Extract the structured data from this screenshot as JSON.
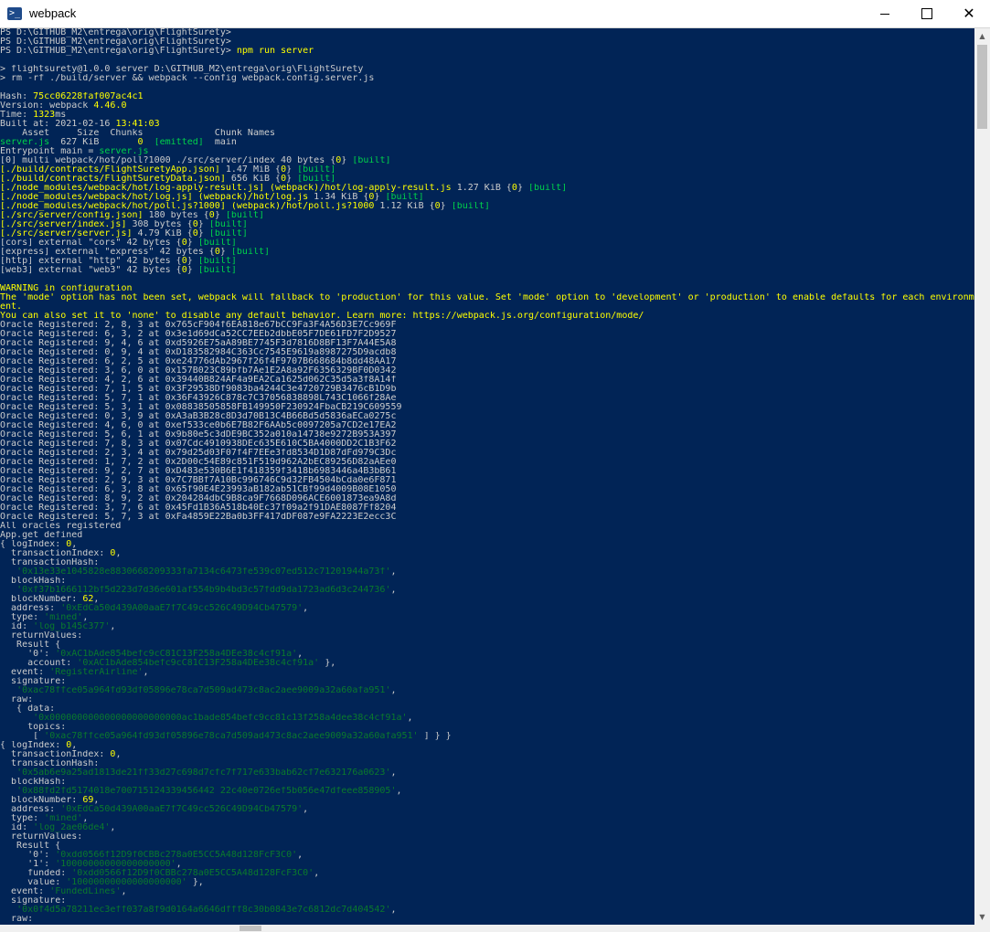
{
  "window": {
    "title": "webpack",
    "icon": "powershell-icon",
    "minimize_icon": "minimize-icon",
    "maximize_icon": "maximize-icon",
    "close_icon": "close-icon"
  },
  "colors": {
    "background": "#012456",
    "text": "#cccccc",
    "yellow": "#ffff00",
    "green": "#00d24a",
    "dark_green": "#0a7a2c",
    "gray": "#9a9a9a"
  },
  "console_lines": [
    [
      {
        "t": "PS D:\\GITHUB_M2\\entrega\\orig\\FlightSurety>"
      }
    ],
    [
      {
        "t": "PS D:\\GITHUB_M2\\entrega\\orig\\FlightSurety>"
      }
    ],
    [
      {
        "t": "PS D:\\GITHUB_M2\\entrega\\orig\\FlightSurety> "
      },
      {
        "t": "npm run server",
        "c": "y"
      }
    ],
    [
      {
        "t": ""
      }
    ],
    [
      {
        "t": "> flightsurety@1.0.0 server D:\\GITHUB_M2\\entrega\\orig\\FlightSurety"
      }
    ],
    [
      {
        "t": "> rm -rf ./build/server && webpack --config webpack.config.server.js"
      }
    ],
    [
      {
        "t": ""
      }
    ],
    [
      {
        "t": "Hash: "
      },
      {
        "t": "75cc06228faf007ac4c1",
        "c": "y"
      }
    ],
    [
      {
        "t": "Version: webpack "
      },
      {
        "t": "4.46.0",
        "c": "y"
      }
    ],
    [
      {
        "t": "Time: "
      },
      {
        "t": "1323",
        "c": "y"
      },
      {
        "t": "ms"
      }
    ],
    [
      {
        "t": "Built at: 2021-02-16 "
      },
      {
        "t": "13:41:03",
        "c": "y"
      }
    ],
    [
      {
        "t": "    Asset     Size  Chunks             Chunk Names"
      }
    ],
    [
      {
        "t": "server.js",
        "c": "g"
      },
      {
        "t": "  627 KiB       "
      },
      {
        "t": "0",
        "c": "y"
      },
      {
        "t": "  "
      },
      {
        "t": "[emitted]",
        "c": "g"
      },
      {
        "t": "  main"
      }
    ],
    [
      {
        "t": "Entrypoint main = "
      },
      {
        "t": "server.js",
        "c": "g"
      }
    ],
    [
      {
        "t": "[0] multi webpack/hot/poll?1000 ./src/server/index 40 bytes {"
      },
      {
        "t": "0",
        "c": "y"
      },
      {
        "t": "} "
      },
      {
        "t": "[built]",
        "c": "g"
      }
    ],
    [
      {
        "t": "[./build/contracts/FlightSuretyApp.json]",
        "c": "y"
      },
      {
        "t": " 1.47 MiB {"
      },
      {
        "t": "0",
        "c": "y"
      },
      {
        "t": "} "
      },
      {
        "t": "[built]",
        "c": "g"
      }
    ],
    [
      {
        "t": "[./build/contracts/FlightSuretyData.json]",
        "c": "y"
      },
      {
        "t": " 656 KiB {"
      },
      {
        "t": "0",
        "c": "y"
      },
      {
        "t": "} "
      },
      {
        "t": "[built]",
        "c": "g"
      }
    ],
    [
      {
        "t": "[./node_modules/webpack/hot/log-apply-result.js]",
        "c": "y"
      },
      {
        "t": " (webpack)/hot/log-apply-result.js",
        "c": "y"
      },
      {
        "t": " 1.27 KiB {"
      },
      {
        "t": "0",
        "c": "y"
      },
      {
        "t": "} "
      },
      {
        "t": "[built]",
        "c": "g"
      }
    ],
    [
      {
        "t": "[./node_modules/webpack/hot/log.js]",
        "c": "y"
      },
      {
        "t": " (webpack)/hot/log.js",
        "c": "y"
      },
      {
        "t": " 1.34 KiB {"
      },
      {
        "t": "0",
        "c": "y"
      },
      {
        "t": "} "
      },
      {
        "t": "[built]",
        "c": "g"
      }
    ],
    [
      {
        "t": "[./node_modules/webpack/hot/poll.js?1000]",
        "c": "y"
      },
      {
        "t": " (webpack)/hot/poll.js?1000",
        "c": "y"
      },
      {
        "t": " 1.12 KiB {"
      },
      {
        "t": "0",
        "c": "y"
      },
      {
        "t": "} "
      },
      {
        "t": "[built]",
        "c": "g"
      }
    ],
    [
      {
        "t": "[./src/server/config.json]",
        "c": "y"
      },
      {
        "t": " 180 bytes {"
      },
      {
        "t": "0",
        "c": "y"
      },
      {
        "t": "} "
      },
      {
        "t": "[built]",
        "c": "g"
      }
    ],
    [
      {
        "t": "[./src/server/index.js]",
        "c": "y"
      },
      {
        "t": " 308 bytes {"
      },
      {
        "t": "0",
        "c": "y"
      },
      {
        "t": "} "
      },
      {
        "t": "[built]",
        "c": "g"
      }
    ],
    [
      {
        "t": "[./src/server/server.js]",
        "c": "y"
      },
      {
        "t": " 4.79 KiB {"
      },
      {
        "t": "0",
        "c": "y"
      },
      {
        "t": "} "
      },
      {
        "t": "[built]",
        "c": "g"
      }
    ],
    [
      {
        "t": "[cors] external \"cors\" 42 bytes {"
      },
      {
        "t": "0",
        "c": "y"
      },
      {
        "t": "} "
      },
      {
        "t": "[built]",
        "c": "g"
      }
    ],
    [
      {
        "t": "[express] external \"express\" 42 bytes {"
      },
      {
        "t": "0",
        "c": "y"
      },
      {
        "t": "} "
      },
      {
        "t": "[built]",
        "c": "g"
      }
    ],
    [
      {
        "t": "[http] external \"http\" 42 bytes {"
      },
      {
        "t": "0",
        "c": "y"
      },
      {
        "t": "} "
      },
      {
        "t": "[built]",
        "c": "g"
      }
    ],
    [
      {
        "t": "[web3] external \"web3\" 42 bytes {"
      },
      {
        "t": "0",
        "c": "y"
      },
      {
        "t": "} "
      },
      {
        "t": "[built]",
        "c": "g"
      }
    ],
    [
      {
        "t": ""
      }
    ],
    [
      {
        "t": "WARNING in configuration",
        "c": "y"
      }
    ],
    [
      {
        "t": "The 'mode' option has not been set, webpack will fallback to 'production' for this value. Set 'mode' option to 'development' or 'production' to enable defaults for each environm",
        "c": "y"
      }
    ],
    [
      {
        "t": "ent.",
        "c": "y"
      }
    ],
    [
      {
        "t": "You can also set it to 'none' to disable any default behavior. Learn more: https://webpack.js.org/configuration/mode/",
        "c": "y"
      }
    ],
    [
      {
        "t": "Oracle Registered: 2, 8, 3 at 0x765cF904f6EA818e67bCC9Fa3F4A56D3E7Cc969F"
      }
    ],
    [
      {
        "t": "Oracle Registered: 6, 3, 2 at 0x3e1d69dCa52CC7EEb2dbbE05F7DE61FD7F2D9527"
      }
    ],
    [
      {
        "t": "Oracle Registered: 9, 4, 6 at 0xd5926E75aA89BE7745F3d7816D8BF13F7A44E5A8"
      }
    ],
    [
      {
        "t": "Oracle Registered: 0, 9, 4 at 0xD183582984C363Cc7545E9619a8987275D9acdb8"
      }
    ],
    [
      {
        "t": "Oracle Registered: 6, 2, 5 at 0xe24776dAb2967f26f4F9707B668684b8dd48AA17"
      }
    ],
    [
      {
        "t": "Oracle Registered: 3, 6, 0 at 0x157B023C89bfb7Ae1E2A8a92F6356329BF0D0342"
      }
    ],
    [
      {
        "t": "Oracle Registered: 4, 2, 6 at 0x39440B824AF4a9EA2Ca1625d062C35d5a3f8A14f"
      }
    ],
    [
      {
        "t": "Oracle Registered: 7, 1, 5 at 0x3F29538Df9083ba4244C3e4720729B3476cB1D9b"
      }
    ],
    [
      {
        "t": "Oracle Registered: 5, 7, 1 at 0x36F43926C878c7C37056838898L743C1066f28Ae"
      }
    ],
    [
      {
        "t": "Oracle Registered: 5, 3, 1 at 0x08838505858FB149950F230924FbaCB219C609559"
      }
    ],
    [
      {
        "t": "Oracle Registered: 0, 3, 9 at 0xA3aB3B28c8D3d70B13C4B66Bd5d5836aECa0275c"
      }
    ],
    [
      {
        "t": "Oracle Registered: 4, 6, 0 at 0xef533ce0b6E7B82F6AAb5c0097205a7CD2e17EA2"
      }
    ],
    [
      {
        "t": "Oracle Registered: 5, 6, 1 at 0x9b80e5c3dDE9BC352a010a14738e9272B953A397"
      }
    ],
    [
      {
        "t": "Oracle Registered: 7, 8, 3 at 0x07Cdc4910938DEc635E610C5BA4000DD2C1B3F62"
      }
    ],
    [
      {
        "t": "Oracle Registered: 2, 3, 4 at 0x79d25d03F07f4F7EEe3fd8534D1D87dFd979C3Dc"
      }
    ],
    [
      {
        "t": "Oracle Registered: 1, 7, 2 at 0x2D00c54E89c851F519d962A2bEC89256D82aAEe0"
      }
    ],
    [
      {
        "t": "Oracle Registered: 9, 2, 7 at 0xD483e530B6E1f418359f3418b6983446a4B3bB61"
      }
    ],
    [
      {
        "t": "Oracle Registered: 2, 9, 3 at 0x7C7BBf7A10Bc996746C9d32FB4504bCda0e6F871"
      }
    ],
    [
      {
        "t": "Oracle Registered: 6, 3, 8 at 0x65f90E4E23993aB182ab51CBf99d4009B08E1050"
      }
    ],
    [
      {
        "t": "Oracle Registered: 8, 9, 2 at 0x204284dbC9B8ca9F7668D096ACE6001873ea9A8d"
      }
    ],
    [
      {
        "t": "Oracle Registered: 3, 7, 6 at 0x45Fd1B36A518b40Ec37f09a2f91DAE8087Ff8204"
      }
    ],
    [
      {
        "t": "Oracle Registered: 5, 7, 3 at 0xFa4859E22Ba0b3FF417dDF087e9FA2223E2ecc3C"
      }
    ],
    [
      {
        "t": "All oracles registered"
      }
    ],
    [
      {
        "t": "App.get defined"
      }
    ],
    [
      {
        "t": "{ logIndex: "
      },
      {
        "t": "0",
        "c": "y"
      },
      {
        "t": ","
      }
    ],
    [
      {
        "t": "  transactionIndex: "
      },
      {
        "t": "0",
        "c": "y"
      },
      {
        "t": ","
      }
    ],
    [
      {
        "t": "  transactionHash:"
      }
    ],
    [
      {
        "t": "   "
      },
      {
        "t": "'0x13e33e1045828e8830668209333fa7134c6473fe539c07ed512c71201944a73f'",
        "c": "dg"
      },
      {
        "t": ","
      }
    ],
    [
      {
        "t": "  blockHash:"
      }
    ],
    [
      {
        "t": "   "
      },
      {
        "t": "'0xf37b1666112bf5d223d7d36e601af554b9b4bd3c57fdd9da1723ad6d3c244736'",
        "c": "dg"
      },
      {
        "t": ","
      }
    ],
    [
      {
        "t": "  blockNumber: "
      },
      {
        "t": "62",
        "c": "y"
      },
      {
        "t": ","
      }
    ],
    [
      {
        "t": "  address: "
      },
      {
        "t": "'0xEdCa50d439A00aaE7f7C49cc526C49D94Cb47579'",
        "c": "dg"
      },
      {
        "t": ","
      }
    ],
    [
      {
        "t": "  type: "
      },
      {
        "t": "'mined'",
        "c": "dg"
      },
      {
        "t": ","
      }
    ],
    [
      {
        "t": "  id: "
      },
      {
        "t": "'log_b145c377'",
        "c": "dg"
      },
      {
        "t": ","
      }
    ],
    [
      {
        "t": "  returnValues:"
      }
    ],
    [
      {
        "t": "   Result {"
      }
    ],
    [
      {
        "t": "     '0': "
      },
      {
        "t": "'0xAC1bAde854befc9cC81C13F258a4DEe38c4cf91a'",
        "c": "dg"
      },
      {
        "t": ","
      }
    ],
    [
      {
        "t": "     account: "
      },
      {
        "t": "'0xAC1bAde854befc9cC81C13F258a4DEe38c4cf91a'",
        "c": "dg"
      },
      {
        "t": " },"
      }
    ],
    [
      {
        "t": "  event: "
      },
      {
        "t": "'RegisterAirline'",
        "c": "dg"
      },
      {
        "t": ","
      }
    ],
    [
      {
        "t": "  signature:"
      }
    ],
    [
      {
        "t": "   "
      },
      {
        "t": "'0xac78ffce05a964fd93df05896e78ca7d509ad473c8ac2aee9009a32a60afa951'",
        "c": "dg"
      },
      {
        "t": ","
      }
    ],
    [
      {
        "t": "  raw:"
      }
    ],
    [
      {
        "t": "   { data:"
      }
    ],
    [
      {
        "t": "      "
      },
      {
        "t": "'0x000000000000000000000000ac1bade854befc9cc81c13f258a4dee38c4cf91a'",
        "c": "dg"
      },
      {
        "t": ","
      }
    ],
    [
      {
        "t": "     topics:"
      }
    ],
    [
      {
        "t": "      [ "
      },
      {
        "t": "'0xac78ffce05a964fd93df05896e78ca7d509ad473c8ac2aee9009a32a60afa951'",
        "c": "dg"
      },
      {
        "t": " ] } }"
      }
    ],
    [
      {
        "t": "{ logIndex: "
      },
      {
        "t": "0",
        "c": "y"
      },
      {
        "t": ","
      }
    ],
    [
      {
        "t": "  transactionIndex: "
      },
      {
        "t": "0",
        "c": "y"
      },
      {
        "t": ","
      }
    ],
    [
      {
        "t": "  transactionHash:"
      }
    ],
    [
      {
        "t": "   "
      },
      {
        "t": "'0x5ab6e9a25ad1813de21ff33d27c698d7cfc7f717e633bab62cf7e632176a0623'",
        "c": "dg"
      },
      {
        "t": ","
      }
    ],
    [
      {
        "t": "  blockHash:"
      }
    ],
    [
      {
        "t": "   "
      },
      {
        "t": "'0x88fd2fd5174018e700715124339456442 22c40e0726ef5b056e47dfeee858905'",
        "c": "dg"
      },
      {
        "t": ","
      }
    ],
    [
      {
        "t": "  blockNumber: "
      },
      {
        "t": "69",
        "c": "y"
      },
      {
        "t": ","
      }
    ],
    [
      {
        "t": "  address: "
      },
      {
        "t": "'0xEdCa50d439A00aaE7f7C49cc526C49D94Cb47579'",
        "c": "dg"
      },
      {
        "t": ","
      }
    ],
    [
      {
        "t": "  type: "
      },
      {
        "t": "'mined'",
        "c": "dg"
      },
      {
        "t": ","
      }
    ],
    [
      {
        "t": "  id: "
      },
      {
        "t": "'log_2ae06de4'",
        "c": "dg"
      },
      {
        "t": ","
      }
    ],
    [
      {
        "t": "  returnValues:"
      }
    ],
    [
      {
        "t": "   Result {"
      }
    ],
    [
      {
        "t": "     '0': "
      },
      {
        "t": "'0xdd0566f12D9f0CBBc278a0E5CC5A48d128FcF3C0'",
        "c": "dg"
      },
      {
        "t": ","
      }
    ],
    [
      {
        "t": "     '1': "
      },
      {
        "t": "'10000000000000000000'",
        "c": "dg"
      },
      {
        "t": ","
      }
    ],
    [
      {
        "t": "     funded: "
      },
      {
        "t": "'0xdd0566f12D9f0CBBc278a0E5CC5A48d128FcF3C0'",
        "c": "dg"
      },
      {
        "t": ","
      }
    ],
    [
      {
        "t": "     value: "
      },
      {
        "t": "'10000000000000000000'",
        "c": "dg"
      },
      {
        "t": " },"
      }
    ],
    [
      {
        "t": "  event: "
      },
      {
        "t": "'FundedLines'",
        "c": "dg"
      },
      {
        "t": ","
      }
    ],
    [
      {
        "t": "  signature:"
      }
    ],
    [
      {
        "t": "   "
      },
      {
        "t": "'0x0f4d5a78211ec3eff037a8f9d0164a6646dfff8c30b0843e7c6812dc7d404542'",
        "c": "dg"
      },
      {
        "t": ","
      }
    ],
    [
      {
        "t": "  raw:"
      }
    ]
  ],
  "scrollbar": {
    "up_icon": "scroll-up-arrow-icon",
    "down_icon": "scroll-down-arrow-icon"
  }
}
